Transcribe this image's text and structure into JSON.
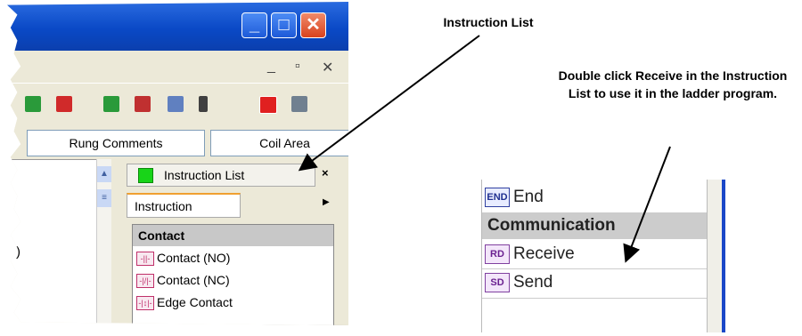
{
  "window": {
    "buttons": {
      "minimize": "_",
      "maximize": "□",
      "close": "✕"
    },
    "mdi_controls": {
      "minimize": "_",
      "restore": "▫",
      "close": "✕"
    }
  },
  "toolbar": {
    "icons": [
      "arrow-green-icon",
      "arrow-red-icon",
      "bar-green-icon",
      "bar-red-icon",
      "device-icon",
      "traffic-light-icon",
      "alarm-icon",
      "tool-icon"
    ]
  },
  "tabs": {
    "rung_comments": "Rung Comments",
    "coil_area": "Coil Area"
  },
  "workarea": {
    "text": ")"
  },
  "instruction_list": {
    "title": "Instruction List",
    "close": "×",
    "tab": "Instruction",
    "category": "Contact",
    "items": [
      {
        "icon": "-||-",
        "label": "Contact (NO)"
      },
      {
        "icon": "-|/|-",
        "label": "Contact (NC)"
      },
      {
        "icon": "-|↕|-",
        "label": "Edge Contact"
      }
    ]
  },
  "annotations": {
    "instruction_list_label": "Instruction List",
    "double_click_note": "Double click Receive in the Instruction List to use it in the ladder program."
  },
  "inset": {
    "rows": [
      {
        "icon": "END",
        "label": "End"
      },
      {
        "label": "Communication"
      },
      {
        "icon": "RD",
        "label": "Receive"
      },
      {
        "icon": "SD",
        "label": "Send"
      }
    ]
  },
  "colors": {
    "titlebar": "#0a49c6",
    "status_green": "#18d418",
    "close_red": "#d8421e"
  }
}
